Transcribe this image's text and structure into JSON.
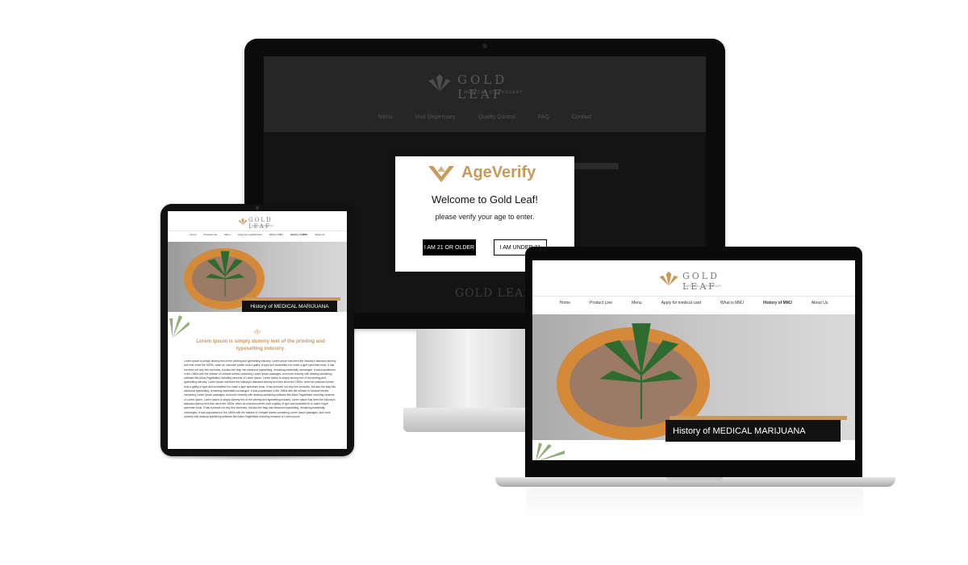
{
  "brand": {
    "name": "GOLD LEAF",
    "tagline": "MEDICAL DISPENSARY",
    "accent": "#c9995a"
  },
  "desktop": {
    "nav": [
      "Menu",
      "Visit Dispensary",
      "Quality Control",
      "FAQ",
      "Contact"
    ],
    "hero_title": "GOLD LEAF",
    "age_verify": {
      "logo_text": "AgeVerify",
      "welcome": "Welcome to Gold Leaf!",
      "prompt": "please verify your age to enter.",
      "btn_older": "I AM 21 OR OLDER",
      "btn_under": "I AM UNDER 21"
    }
  },
  "tablet": {
    "nav": [
      "Home",
      "Product Line",
      "Menu",
      "Apply for medical card",
      "What is MMJ",
      "History of MMJ",
      "About Us"
    ],
    "hero_title": "History of MEDICAL MARIJUANA",
    "heading": "Lorem Ipsum is simply dummy text of the printing and typesetting industry.",
    "body": "Lorem Ipsum is simply dummy text of the printing and typesetting industry. Lorem Ipsum has been the industry's standard dummy text ever since the 1500s, when an unknown printer took a galley of type and scrambled it to make a type specimen book. It has survived not only five centuries, but also the leap into electronic typesetting, remaining essentially unchanged. It was popularised in the 1960s with the release of Letraset sheets containing Lorem Ipsum passages, and more recently with desktop publishing software like Aldus PageMaker including versions of Lorem Ipsum. Lorem Ipsum is simply dummy text of the printing and typesetting industry. Lorem Ipsum has been the industry's standard dummy text ever since the 1500s, when an unknown printer took a galley of type and scrambled it to make a type specimen book. It has survived not only five centuries, but also the leap into electronic typesetting, remaining essentially unchanged. It was popularised in the 1960s with the release of Letraset sheets containing Lorem Ipsum passages, and more recently with desktop publishing software like Aldus PageMaker including versions of Lorem Ipsum. Lorem Ipsum is simply dummy text of the printing and typesetting industry. Lorem Ipsum has been the industry's standard dummy text ever since the 1500s, when an unknown printer took a galley of type and scrambled it to make a type specimen book. It has survived not only five centuries, but also the leap into electronic typesetting, remaining essentially unchanged. It was popularised in the 1960s with the release of Letraset sheets containing Lorem Ipsum passages, and more recently with desktop publishing software like Aldus PageMaker including versions of Lorem Ipsum."
  },
  "laptop": {
    "nav": [
      "Home",
      "Product Line",
      "Menu",
      "Apply for medical card",
      "What is MMJ",
      "History of MMJ",
      "About Us"
    ],
    "active_nav": "History of MMJ",
    "hero_title": "History of MEDICAL MARIJUANA"
  }
}
